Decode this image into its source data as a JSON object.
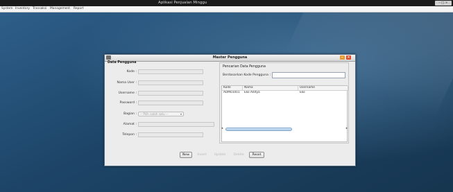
{
  "window": {
    "title": "Aplikasi Penjualan Minggu",
    "controls": "– □ ×"
  },
  "menu": [
    "System",
    "Inventory",
    "Transaksi",
    "Management",
    "Report"
  ],
  "dialog": {
    "title": "Master Pengguna",
    "section_title": "Data Pengguna",
    "form": {
      "kode_label": "Kode :",
      "nama_label": "Nama User :",
      "username_label": "Username :",
      "password_label": "Password :",
      "bagian_label": "Bagian :",
      "bagian_placeholder": "-- Pilih salah satu --",
      "alamat_label": "Alamat :",
      "telepon_label": "Telepon :"
    },
    "search": {
      "section_title": "Pencarian Data Pengguna",
      "label": "Berdasarkan Kode Pengguna :",
      "value": ""
    },
    "table": {
      "columns": [
        "Kode",
        "Nama",
        "Username"
      ],
      "rows": [
        [
          "ADM01001",
          "Eko Aditya",
          "Eko"
        ]
      ]
    },
    "buttons": {
      "new": "New",
      "insert": "Insert",
      "update": "Update",
      "delete": "Delete",
      "reset": "Reset"
    }
  },
  "colors": {
    "desktop": "#1d4568",
    "close_button": "#e14b2b",
    "minimize_button": "#e89b2e"
  }
}
